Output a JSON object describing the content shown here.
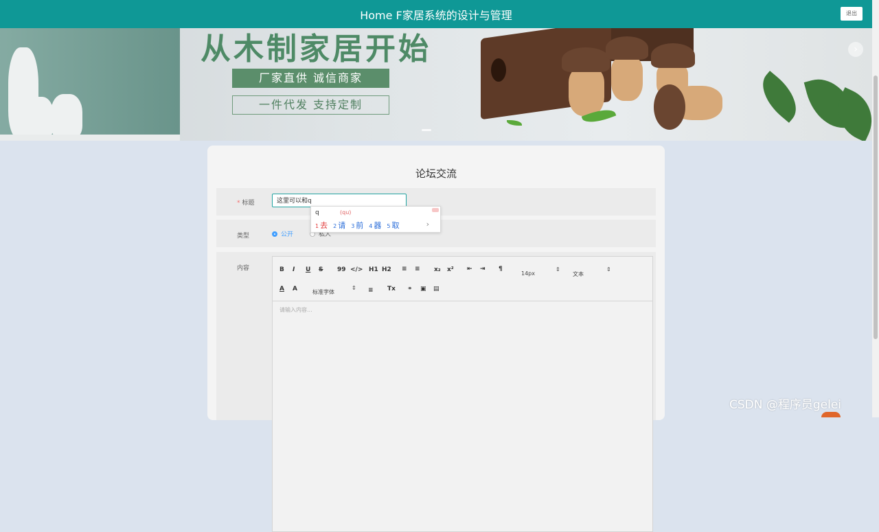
{
  "header": {
    "title": "Home F家居系统的设计与管理",
    "logout_label": "退出"
  },
  "banner": {
    "headline": "从木制家居开始",
    "tag_solid": "厂家直供  诚信商家",
    "tag_outline": "一件代发  支持定制"
  },
  "form": {
    "title": "论坛交流",
    "title_field": {
      "label": "标题",
      "required_mark": "*",
      "value": "这里可以和q"
    },
    "type_field": {
      "label": "类型",
      "options": [
        {
          "label": "公开",
          "selected": true
        },
        {
          "label": "私人",
          "selected": false
        }
      ]
    },
    "content_field": {
      "label": "内容",
      "placeholder": "请输入内容...",
      "toolbar": {
        "bold": "B",
        "italic": "I",
        "underline": "U",
        "strike": "S",
        "blockquote": "99",
        "code": "</>",
        "h1": "H1",
        "h2": "H2",
        "ordered_list": "≡",
        "bullet_list": "≡",
        "subscript": "x₂",
        "superscript": "x²",
        "outdent": "⇤",
        "indent": "⇥",
        "direction": "¶",
        "size_select": "14px",
        "header_select": "文本",
        "font_select": "标准字体",
        "color": "A",
        "background": "A",
        "align": "≡",
        "clean": "Tx"
      }
    }
  },
  "ime": {
    "typed": "q",
    "pinyin": "(qu)",
    "candidates": [
      {
        "n": "1",
        "text": "去"
      },
      {
        "n": "2",
        "text": "请"
      },
      {
        "n": "3",
        "text": "前"
      },
      {
        "n": "4",
        "text": "器"
      },
      {
        "n": "5",
        "text": "取"
      }
    ],
    "next": "›"
  },
  "watermark": "CSDN @程序员gelei",
  "colors": {
    "header": "#0f9896",
    "accent": "#409eff",
    "banner_green": "#5b8e6b"
  }
}
